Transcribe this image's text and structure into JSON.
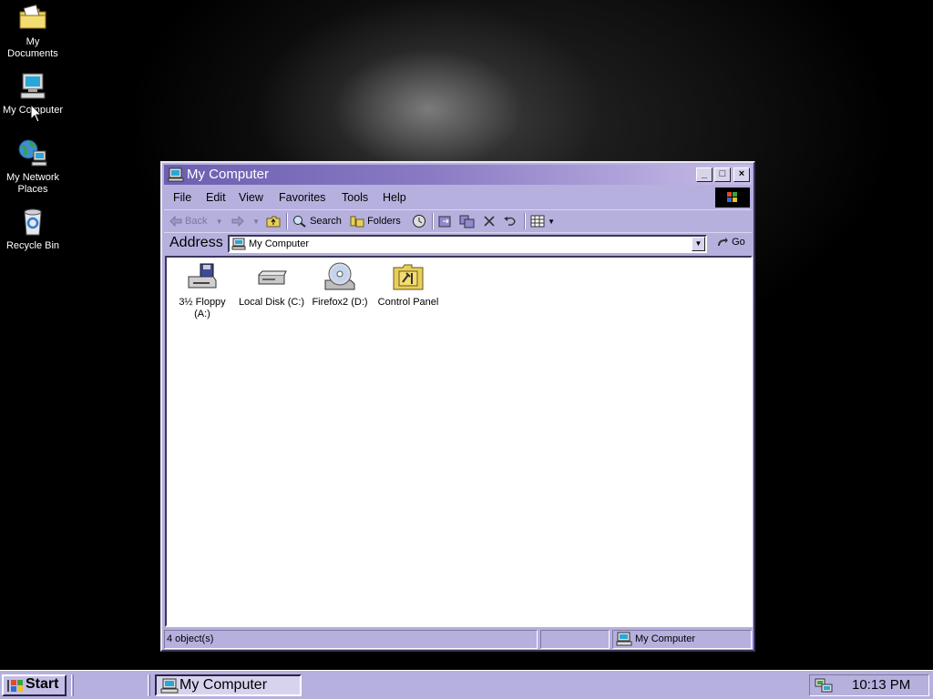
{
  "desktop": {
    "icons": [
      {
        "label": "My Documents",
        "icon": "folder-documents-icon"
      },
      {
        "label": "My Computer",
        "icon": "computer-icon"
      },
      {
        "label": "My Network",
        "label2": "Places",
        "icon": "network-places-icon"
      },
      {
        "label": "Recycle Bin",
        "icon": "recycle-bin-icon"
      }
    ]
  },
  "window": {
    "title": "My Computer",
    "controls": {
      "minimize": "_",
      "maximize": "□",
      "close": "×"
    },
    "menu": [
      "File",
      "Edit",
      "View",
      "Favorites",
      "Tools",
      "Help"
    ],
    "toolbar": {
      "back": "Back",
      "search": "Search",
      "folders": "Folders"
    },
    "address": {
      "label": "Address",
      "value": "My Computer",
      "go": "Go"
    },
    "items": [
      {
        "label": "3½ Floppy",
        "label2": "(A:)",
        "icon": "floppy-drive-icon"
      },
      {
        "label": "Local Disk (C:)",
        "icon": "hard-disk-icon"
      },
      {
        "label": "Firefox2 (D:)",
        "icon": "cd-drive-icon"
      },
      {
        "label": "Control Panel",
        "icon": "control-panel-icon"
      }
    ],
    "status": {
      "objects": "4 object(s)",
      "zone": "My Computer"
    }
  },
  "taskbar": {
    "start": "Start",
    "task": "My Computer",
    "clock": "10:13 PM"
  },
  "colors": {
    "titlebar_start": "#6b5fb0",
    "titlebar_end": "#c9bde8",
    "chrome": "#b6b0de",
    "desktop": "#000000"
  }
}
